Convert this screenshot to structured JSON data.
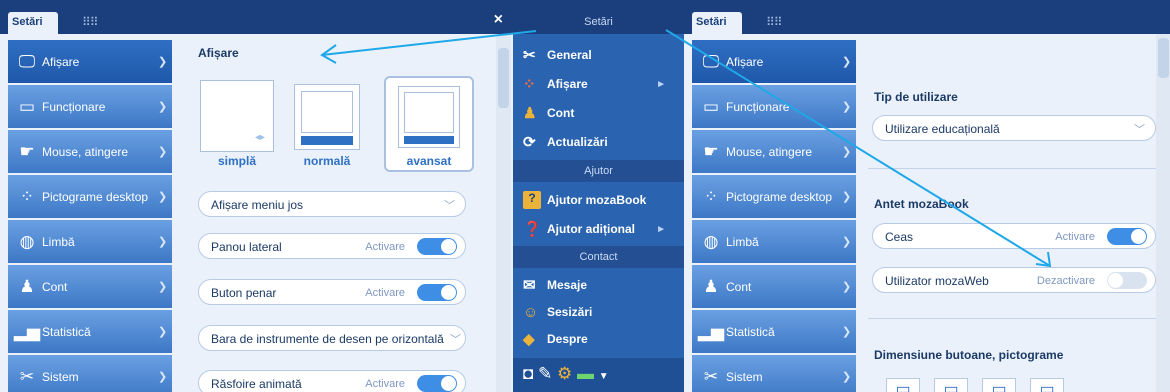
{
  "colors": {
    "title_bar": "#1b3f7d",
    "menu_bg": "#2a63b0",
    "accent": "#3f8ee6",
    "annotation": "#1fa8e8"
  },
  "left_window": {
    "tab": "Setări",
    "close": "×",
    "sidebar": [
      {
        "label": "Afișare",
        "icon": "monitor-icon"
      },
      {
        "label": "Funcționare",
        "icon": "window-icon"
      },
      {
        "label": "Mouse, atingere",
        "icon": "touch-icon"
      },
      {
        "label": "Pictograme desktop",
        "icon": "grid-dots-icon"
      },
      {
        "label": "Limbă",
        "icon": "globe-icon"
      },
      {
        "label": "Cont",
        "icon": "user-icon"
      },
      {
        "label": "Statistică",
        "icon": "bars-icon"
      },
      {
        "label": "Sistem",
        "icon": "tools-icon"
      }
    ],
    "section_title": "Afișare",
    "layouts": [
      {
        "label": "simplă"
      },
      {
        "label": "normală"
      },
      {
        "label": "avansat"
      }
    ],
    "selected_layout": "avansat",
    "menu_select": "Afișare meniu jos",
    "toggles": [
      {
        "label": "Panou lateral",
        "state_text": "Activare",
        "on": true
      },
      {
        "label": "Buton penar",
        "state_text": "Activare",
        "on": true
      }
    ],
    "toolbar_select": "Bara de instrumente de desen pe orizontală",
    "animated": {
      "label": "Răsfoire animată",
      "state_text": "Activare",
      "on": true
    }
  },
  "menu": {
    "title": "Setări",
    "items": [
      {
        "label": "General",
        "icon": "tools-icon"
      },
      {
        "label": "Afișare",
        "icon": "dots-icon",
        "arrow": "►"
      },
      {
        "label": "Cont",
        "icon": "user-icon"
      },
      {
        "label": "Actualizări",
        "icon": "refresh-icon"
      }
    ],
    "help_header": "Ajutor",
    "help_items": [
      {
        "label": "Ajutor mozaBook",
        "icon": "question-box-icon"
      },
      {
        "label": "Ajutor adițional",
        "icon": "question-circle-icon",
        "arrow": "►"
      }
    ],
    "contact_header": "Contact",
    "contact_items": [
      {
        "label": "Mesaje",
        "icon": "envelope-icon"
      },
      {
        "label": "Sesizări",
        "icon": "speech-icon"
      },
      {
        "label": "Despre",
        "icon": "info-diamond-icon"
      }
    ],
    "bottom_icons": [
      "camera-icon",
      "pen-icon",
      "gear-icon",
      "keyboard-icon",
      "dropdown-icon"
    ]
  },
  "right_window": {
    "tab": "Setări",
    "usage_label": "Tip de utilizare",
    "usage_value": "Utilizare educațională",
    "header_label": "Antet mozaBook",
    "clock": {
      "label": "Ceas",
      "state_text": "Activare",
      "on": true
    },
    "user": {
      "label": "Utilizator mozaWeb",
      "state_text": "Dezactivare",
      "on": false
    },
    "buttons_label": "Dimensiune butoane, pictograme"
  }
}
